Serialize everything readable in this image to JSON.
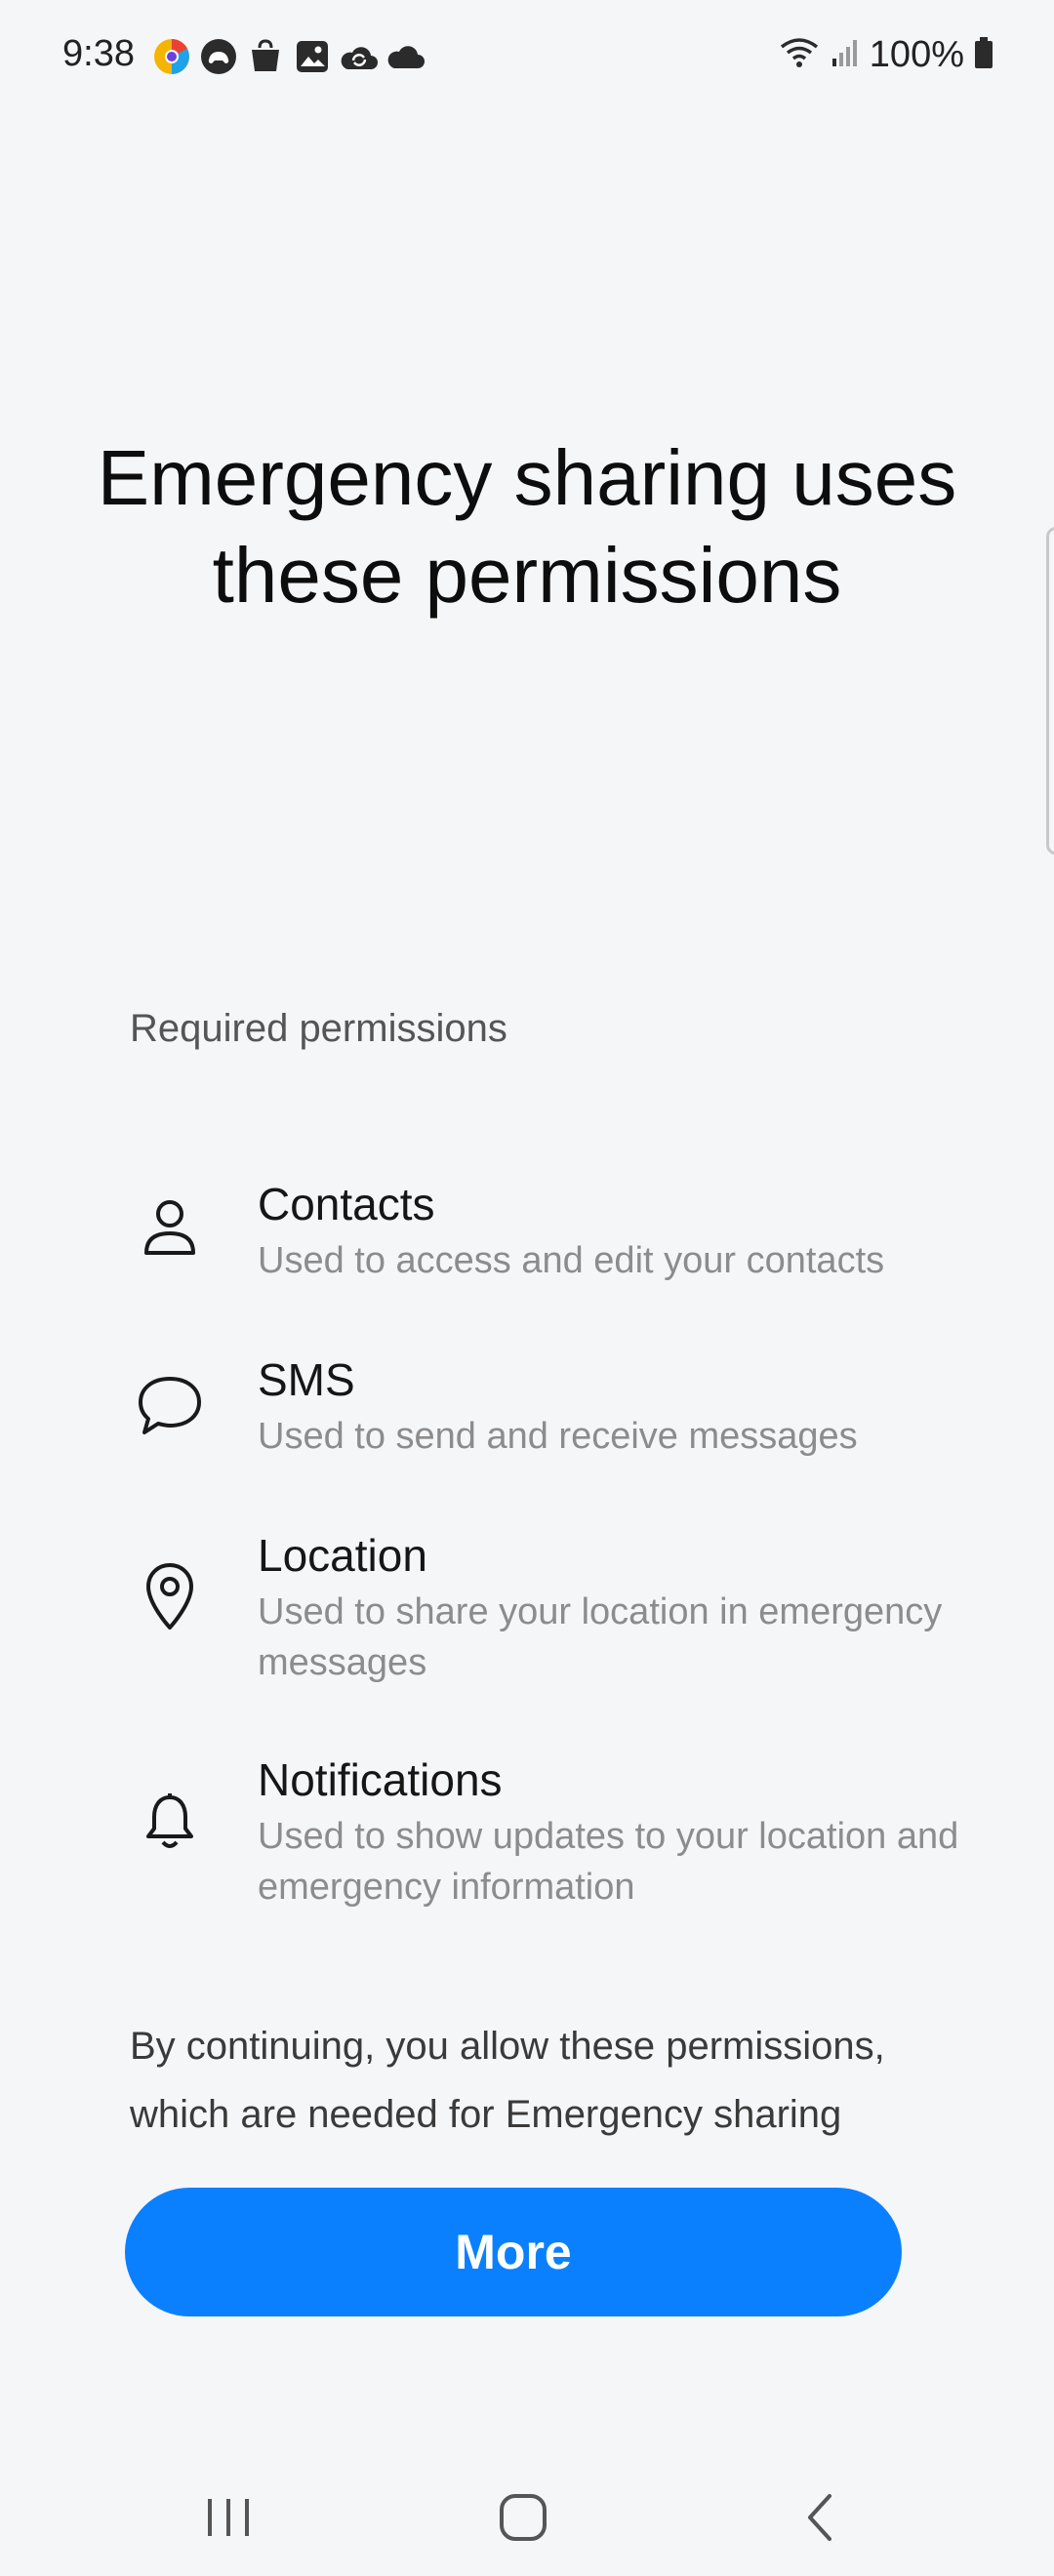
{
  "status_bar": {
    "time": "9:38",
    "battery": "100%",
    "notification_icons": [
      "chrome-like-icon",
      "game-controller-icon",
      "shopping-bag-icon",
      "gallery-icon",
      "sync-icon",
      "cloud-icon"
    ],
    "signal_icons": [
      "wifi-icon",
      "signal-bars-icon",
      "battery-icon"
    ]
  },
  "title": "Emergency sharing uses these permissions",
  "section_header": "Required permissions",
  "permissions": [
    {
      "icon": "person-icon",
      "title": "Contacts",
      "description": "Used to access and edit your contacts"
    },
    {
      "icon": "message-bubble-icon",
      "title": "SMS",
      "description": "Used to send and receive messages"
    },
    {
      "icon": "location-pin-icon",
      "title": "Location",
      "description": "Used to share your location in emergency messages"
    },
    {
      "icon": "bell-icon",
      "title": "Notifications",
      "description": "Used to show updates to your location and emergency information"
    }
  ],
  "footer_text": "By continuing, you allow these permissions, which are needed for Emergency sharing",
  "more_button_label": "More",
  "nav": {
    "recents": "recents-icon",
    "home": "home-icon",
    "back": "back-icon"
  },
  "colors": {
    "background": "#f5f6f8",
    "accent": "#0a80ff",
    "secondary_text": "#8c8c8c"
  }
}
